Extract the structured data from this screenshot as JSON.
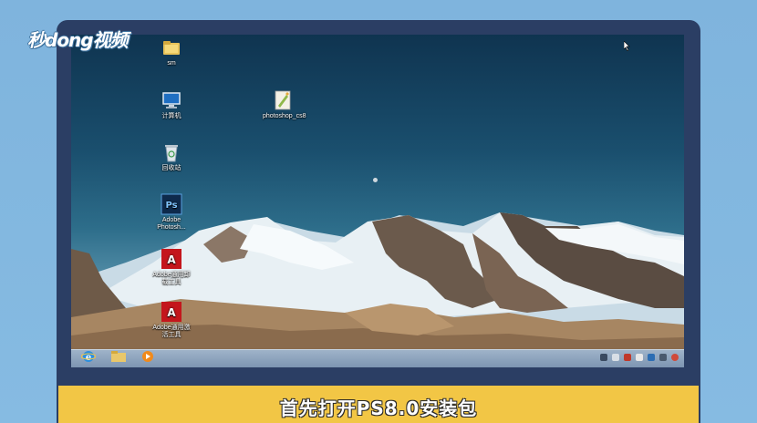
{
  "watermark": {
    "text": "秒dong视频"
  },
  "desktop": {
    "icons": [
      {
        "label": "sm",
        "icon": "folder-icon"
      },
      {
        "label": "计算机",
        "icon": "computer-icon"
      },
      {
        "label": "回收站",
        "icon": "recycle-bin-icon"
      },
      {
        "label": "Adobe Photosh...",
        "icon": "photoshop-icon"
      },
      {
        "label": "Adobe通用卸载工具",
        "icon": "adobe-uninstaller-icon"
      },
      {
        "label": "Adobe通用激活工具",
        "icon": "adobe-activator-icon"
      },
      {
        "label": "photoshop_cs8",
        "icon": "photoshop-installer-icon"
      }
    ]
  },
  "taskbar": {
    "buttons": [
      {
        "name": "ie-browser",
        "icon": "ie-icon"
      },
      {
        "name": "file-explorer",
        "icon": "folder-icon"
      },
      {
        "name": "media-player",
        "icon": "media-player-icon"
      }
    ],
    "tray_icons": [
      "action-center-icon",
      "network-icon",
      "volume-icon",
      "flag-icon",
      "input-icon",
      "shield-icon",
      "power-icon"
    ]
  },
  "caption": {
    "text": "首先打开PS8.0安装包"
  },
  "colors": {
    "caption_bar": "#f2c645",
    "monitor_frame": "#2b3e64",
    "background": "#84b9e0"
  }
}
